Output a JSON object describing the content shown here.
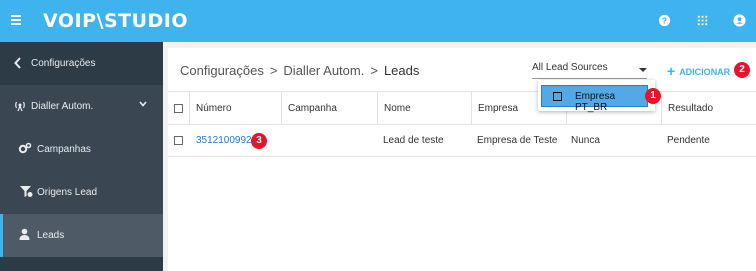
{
  "header": {
    "logo": "VOIP\\STUDIO",
    "icons": [
      "menu-icon",
      "help-icon",
      "apps-grid-icon",
      "account-icon"
    ],
    "bg_color": "#3fb3ee"
  },
  "sidebar": {
    "items": [
      {
        "label": "Configurações",
        "icon": "chevron-left-icon"
      },
      {
        "label": "Dialler Autom.",
        "icon": "dialler-icon",
        "expanded": true
      },
      {
        "label": "Campanhas",
        "icon": "gears-icon"
      },
      {
        "label": "Origens Lead",
        "icon": "funnel-icon"
      },
      {
        "label": "Leads",
        "icon": "user-icon",
        "active": true
      }
    ]
  },
  "breadcrumb": {
    "items": [
      "Configurações",
      "Dialler Autom.",
      "Leads"
    ],
    "separator": ">"
  },
  "filter": {
    "selected": "All Lead Sources",
    "options": [
      "Empresa PT_BR"
    ]
  },
  "toolbar": {
    "add_label": "ADICIONAR"
  },
  "badges": {
    "one": "1",
    "two": "2",
    "three": "3"
  },
  "table": {
    "columns": [
      "Número",
      "Campanha",
      "Nome",
      "Empresa",
      "",
      "Resultado"
    ],
    "rows": [
      {
        "numero": "35121009921",
        "campanha": "",
        "nome": "Lead de teste",
        "empresa": "Empresa de Teste",
        "col5": "Nunca",
        "resultado": "Pendente"
      }
    ]
  }
}
